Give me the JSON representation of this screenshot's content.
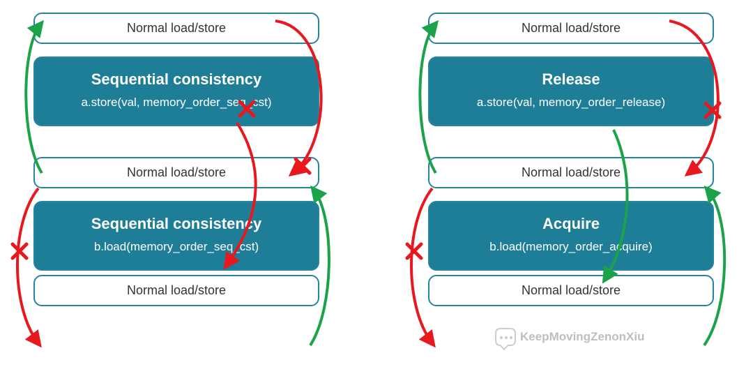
{
  "left": {
    "box1": "Normal load/store",
    "box2_title": "Sequential consistency",
    "box2_code": "a.store(val, memory_order_seq_cst)",
    "box3": "Normal load/store",
    "box4_title": "Sequential consistency",
    "box4_code": "b.load(memory_order_seq_cst)",
    "box5": "Normal load/store"
  },
  "right": {
    "box1": "Normal load/store",
    "box2_title": "Release",
    "box2_code": "a.store(val, memory_order_release)",
    "box3": "Normal load/store",
    "box4_title": "Acquire",
    "box4_code": "b.load(memory_order_acquire)",
    "box5": "Normal load/store"
  },
  "watermark": "KeepMovingZenonXiu",
  "colors": {
    "teal": "#1f7e97",
    "green": "#1aa34a",
    "red": "#e7181e"
  }
}
